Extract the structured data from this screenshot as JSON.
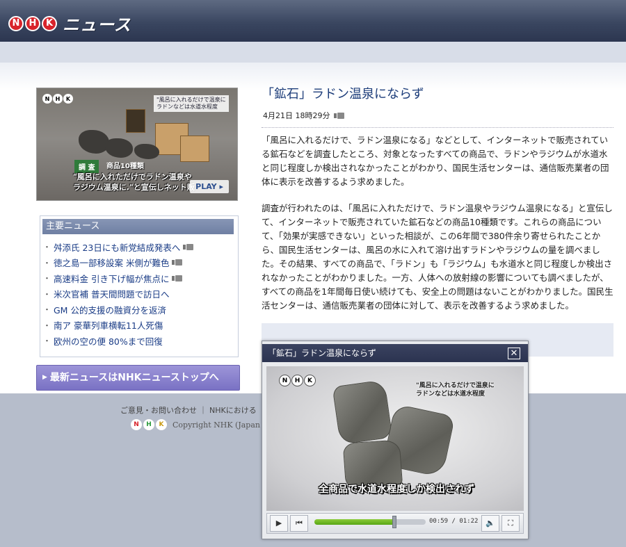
{
  "header": {
    "logo_letters": [
      "N",
      "H",
      "K"
    ],
    "logo_text": "ニュース"
  },
  "thumbnail": {
    "logo_letters": [
      "N",
      "H",
      "K"
    ],
    "caption_top": "\"風呂に入れるだけで温泉に\nラドンなどは水道水程度",
    "label_chousa": "調 査",
    "label_items": "商品10種類",
    "caption_bottom": "\"風呂に入れただけでラドン温泉や\nラジウム温泉に.\"と宣伝しネット販",
    "play_label": "PLAY ▸"
  },
  "major_news": {
    "title": "主要ニュース",
    "items": [
      {
        "text": "舛添氏 23日にも新党結成発表へ",
        "video": true
      },
      {
        "text": "徳之島一部移設案 米側が難色",
        "video": true
      },
      {
        "text": "高速料金 引き下げ幅が焦点に",
        "video": true
      },
      {
        "text": "米次官補 普天間問題で訪日へ",
        "video": false
      },
      {
        "text": "GM 公的支援の融資分を返済",
        "video": false
      },
      {
        "text": "南ア 豪華列車横転11人死傷",
        "video": false
      },
      {
        "text": "欧州の空の便 80%まで回復",
        "video": false
      }
    ]
  },
  "top_button": {
    "label": "最新ニュースはNHKニューストップへ"
  },
  "article": {
    "title": "「鉱石」ラドン温泉にならず",
    "timestamp": "4月21日 18時29分",
    "paragraph1": "「風呂に入れるだけで、ラドン温泉になる」などとして、インターネットで販売されている鉱石などを調査したところ、対象となったすべての商品で、ラドンやラジウムが水道水と同じ程度しか検出されなかったことがわかり、国民生活センターは、通信販売業者の団体に表示を改善するよう求めました。",
    "paragraph2": "調査が行われたのは、「風呂に入れただけで、ラドン温泉やラジウム温泉になる」と宣伝して、インターネットで販売されていた鉱石などの商品10種類です。これらの商品について、「効果が実感できない」といった相談が、この6年間で380件余り寄せられたことから、国民生活センターは、風呂の水に入れて溶け出すラドンやラジウムの量を調べました。その結果、すべての商品で、「ラドン」も「ラジウム」も水道水と同じ程度しか検出されなかったことがわかりました。一方、人体への放射線の影響についても調べましたが、すべての商品を1年間毎日使い続けても、安全上の問題はないことがわかりました。国民生活センターは、通信販売業者の団体に対して、表示を改善するよう求めました。"
  },
  "footer": {
    "links": "ご意見・お問い合わせ ｜ NHKにおける",
    "logo_letters": [
      "N",
      "H",
      "K"
    ],
    "copyright": "Copyright NHK (Japan Br"
  },
  "player": {
    "title": "「鉱石」ラドン温泉にならず",
    "close_glyph": "✕",
    "screen_logo": [
      "N",
      "H",
      "K"
    ],
    "screen_caption": "\"風呂に入れるだけで温泉に\nラドンなどは水道水程度",
    "subtitle": "全商品で水道水程度しか検出されず",
    "time": "00:59 / 01:22",
    "progress": 0.72,
    "icons": {
      "play": "▶",
      "prev": "⏮",
      "volume": "🔈",
      "fullscreen": "⛶"
    }
  }
}
